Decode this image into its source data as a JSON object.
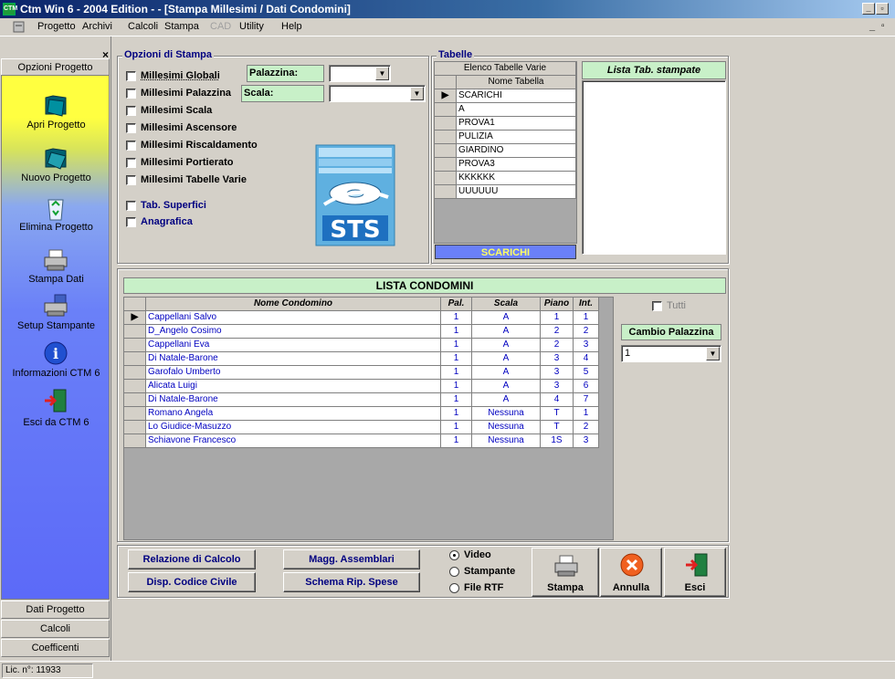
{
  "window": {
    "title": "Ctm Win 6 - 2004 Edition - - [Stampa Millesimi / Dati Condomini]",
    "app_icon_text": "CTM"
  },
  "menu": {
    "items": [
      "Progetto",
      "Archivi",
      "Calcoli",
      "Stampa",
      "CAD",
      "Utility",
      "Help"
    ]
  },
  "sidebar": {
    "top_tab": "Opzioni Progetto",
    "close_glyph": "×",
    "items": [
      {
        "label": "Apri Progetto",
        "icon": "folder-open-icon"
      },
      {
        "label": "Nuovo Progetto",
        "icon": "folder-new-icon"
      },
      {
        "label": "Elimina Progetto",
        "icon": "recycle-bin-icon"
      },
      {
        "label": "Stampa Dati",
        "icon": "printer-icon"
      },
      {
        "label": "Setup Stampante",
        "icon": "printer-setup-icon"
      },
      {
        "label": "Informazioni CTM 6",
        "icon": "info-icon"
      },
      {
        "label": "Esci da CTM 6",
        "icon": "exit-door-icon"
      }
    ],
    "bottom_tabs": [
      "Dati Progetto",
      "Calcoli",
      "Coefficenti"
    ]
  },
  "print_options": {
    "title": "Opzioni di Stampa",
    "checkboxes": [
      "Millesimi Globali",
      "Millesimi Palazzina",
      "Millesimi Scala",
      "Millesimi Ascensore",
      "Millesimi Riscaldamento",
      "Millesimi Portierato",
      "Millesimi Tabelle Varie",
      "Tab. Superfici",
      "Anagrafica"
    ],
    "palazzina_label": "Palazzina:",
    "palazzina_value": "",
    "scala_label": "Scala:",
    "scala_value": "",
    "logo_text": "STS"
  },
  "tabelle": {
    "title": "Tabelle",
    "grid_title": "Elenco Tabelle Varie",
    "column": "Nome Tabella",
    "rows": [
      "SCARICHI",
      "A",
      "PROVA1",
      "PULIZIA",
      "GIARDINO",
      "PROVA3",
      "KKKKKK",
      "UUUUUU"
    ],
    "selected_label": "SCARICHI",
    "list_title": "Lista Tab. stampate"
  },
  "condomini": {
    "title": "LISTA CONDOMINI",
    "columns": [
      "Nome Condomino",
      "Pal.",
      "Scala",
      "Piano",
      "Int."
    ],
    "rows": [
      [
        "Cappellani Salvo",
        "1",
        "A",
        "1",
        "1"
      ],
      [
        "D_Angelo Cosimo",
        "1",
        "A",
        "2",
        "2"
      ],
      [
        "Cappellani Eva",
        "1",
        "A",
        "2",
        "3"
      ],
      [
        "Di Natale-Barone",
        "1",
        "A",
        "3",
        "4"
      ],
      [
        "Garofalo Umberto",
        "1",
        "A",
        "3",
        "5"
      ],
      [
        "Alicata Luigi",
        "1",
        "A",
        "3",
        "6"
      ],
      [
        "Di Natale-Barone",
        "1",
        "A",
        "4",
        "7"
      ],
      [
        "Romano Angela",
        "1",
        "Nessuna",
        "T",
        "1"
      ],
      [
        "Lo Giudice-Masuzzo",
        "1",
        "Nessuna",
        "T",
        "2"
      ],
      [
        "Schiavone Francesco",
        "1",
        "Nessuna",
        "1S",
        "3"
      ]
    ],
    "tutti_label": "Tutti",
    "cambio_label": "Cambio Palazzina",
    "cambio_value": "1"
  },
  "actions": {
    "relazione": "Relazione di Calcolo",
    "magg": "Magg. Assemblari",
    "disp": "Disp. Codice Civile",
    "schema": "Schema Rip. Spese",
    "output_options": [
      "Video",
      "Stampante",
      "File RTF"
    ],
    "selected_output": "Video",
    "stampa": "Stampa",
    "annulla": "Annulla",
    "esci": "Esci"
  },
  "status": {
    "license": "Lic. n°: 11933"
  },
  "colors": {
    "title_bar": "#0a246a",
    "group_title": "#000080",
    "list_green": "#c8f0c8",
    "selected_blue": "#6a80f8"
  }
}
